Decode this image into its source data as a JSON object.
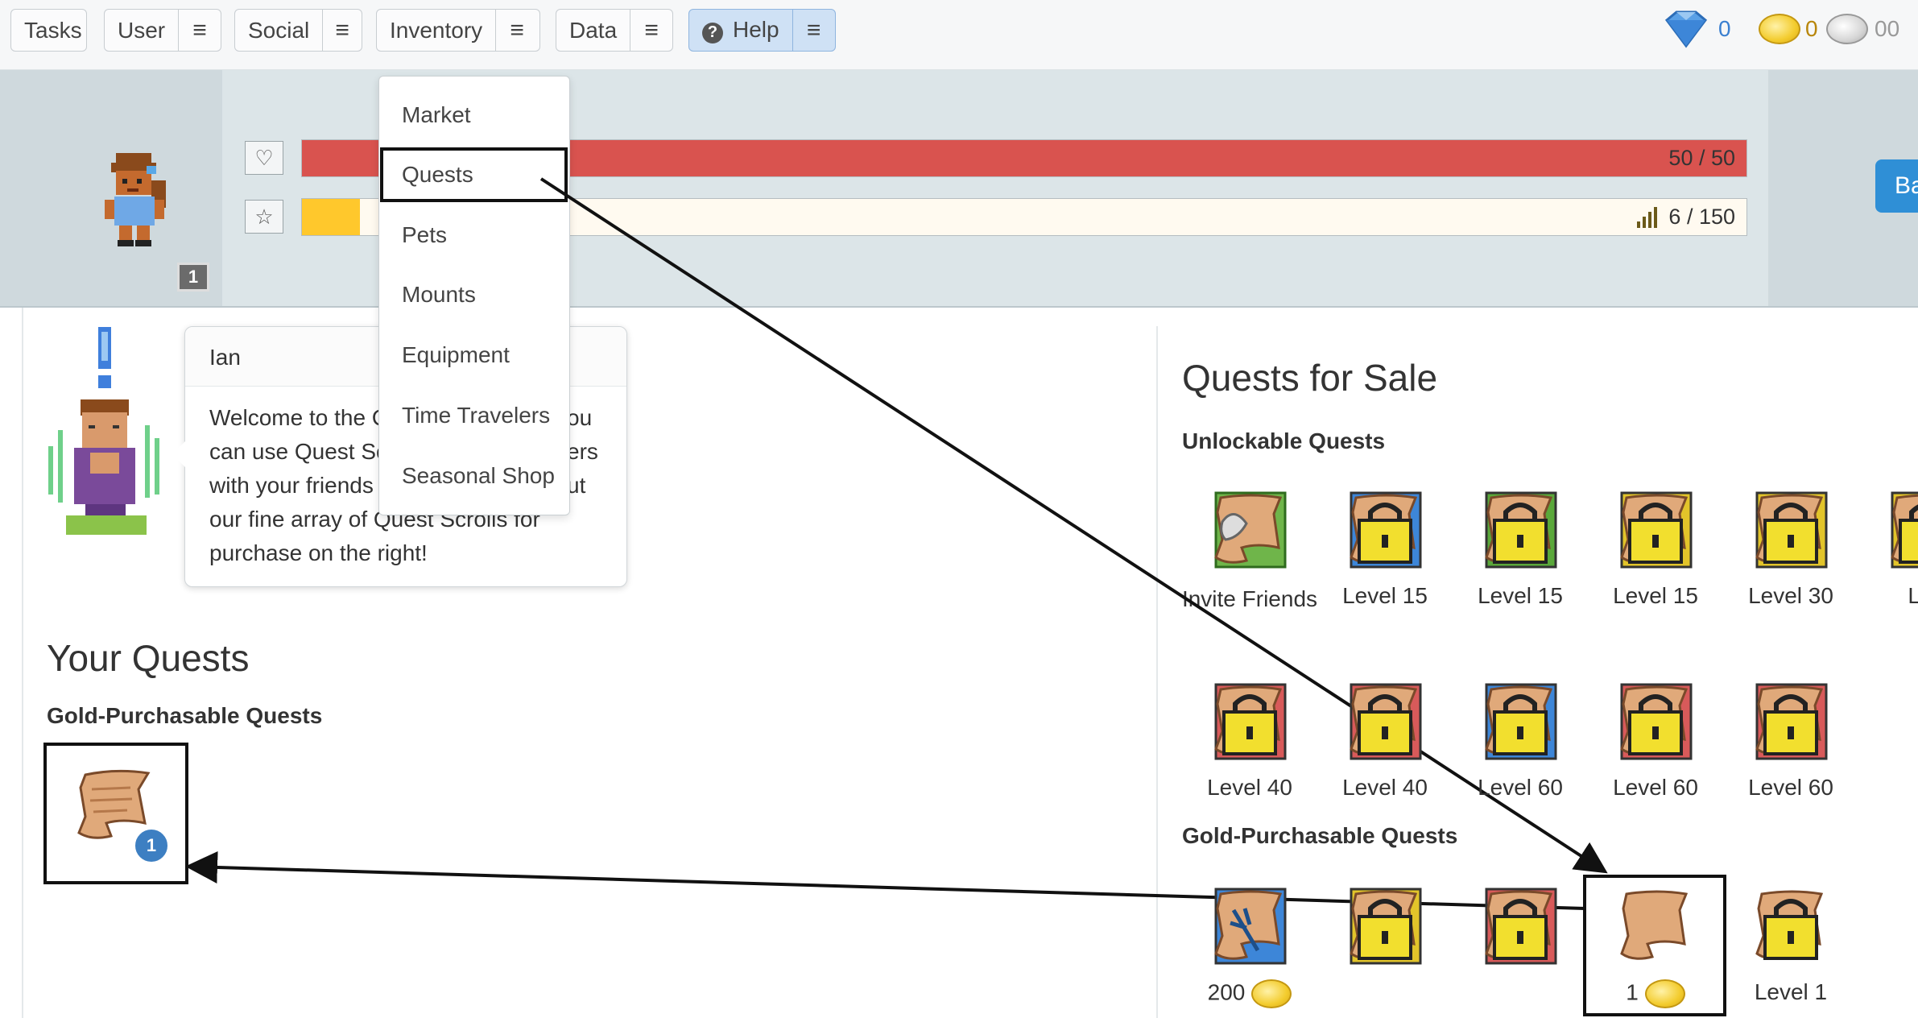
{
  "nav": {
    "tasks": "Tasks",
    "user": "User",
    "social": "Social",
    "inventory": "Inventory",
    "data": "Data",
    "help": "Help",
    "menu_glyph": "≡"
  },
  "currency": {
    "gems": "0",
    "gold": "0",
    "silver": "00",
    "gem_color": "#3a7fd0",
    "gold_color": "#b8860b"
  },
  "stats": {
    "health_text": "50 / 50",
    "health_fraction": 1.0,
    "health_color": "#d9534f",
    "exp_text": "6 / 150",
    "exp_fraction": 0.04,
    "exp_color": "#ffc82c",
    "level_badge": "1",
    "side_button": "Ba"
  },
  "inventory_menu": {
    "items": [
      "Market",
      "Quests",
      "Pets",
      "Mounts",
      "Equipment",
      "Time Travelers",
      "Seasonal Shop"
    ]
  },
  "npc": {
    "name": "Ian",
    "message": "Welcome to the Quest Shop! Here you can use Quest Scrolls to battle monsters with your friends. Be sure to check out our fine array of Quest Scrolls for purchase on the right!",
    "visible_lines": [
      "Welcome to the C",
      "can use Quest Scr",
      "with your friends",
      "our fine array of Quest Scrolls for",
      "purchase on the right!"
    ],
    "peek_right": [
      "ou",
      "ers",
      "ut"
    ]
  },
  "your_quests": {
    "title": "Your Quests",
    "subtitle": "Gold-Purchasable Quests",
    "owned_count": "1"
  },
  "shop": {
    "title": "Quests for Sale",
    "unlockable_title": "Unlockable Quests",
    "unlockable_row1": [
      "Invite Friends",
      "Level 15",
      "Level 15",
      "Level 15",
      "Level 30",
      "Lev"
    ],
    "unlockable_row2": [
      "Level 40",
      "Level 40",
      "Level 60",
      "Level 60",
      "Level 60"
    ],
    "gold_title": "Gold-Purchasable Quests",
    "gold_items": [
      {
        "label": "200",
        "coin": true
      },
      {
        "label": "",
        "coin": false
      },
      {
        "label": "",
        "coin": false
      },
      {
        "label": "1",
        "coin": true
      },
      {
        "label": "Level 1",
        "coin": false
      }
    ]
  },
  "icons": {
    "heart": "heart-icon",
    "star": "star-icon",
    "gem": "gem-icon",
    "coin": "gold-coin-icon",
    "silver": "silver-coin-icon",
    "help": "question-icon",
    "scroll": "quest-scroll-icon",
    "lock": "lock-icon",
    "bars": "signal-bars-icon"
  }
}
